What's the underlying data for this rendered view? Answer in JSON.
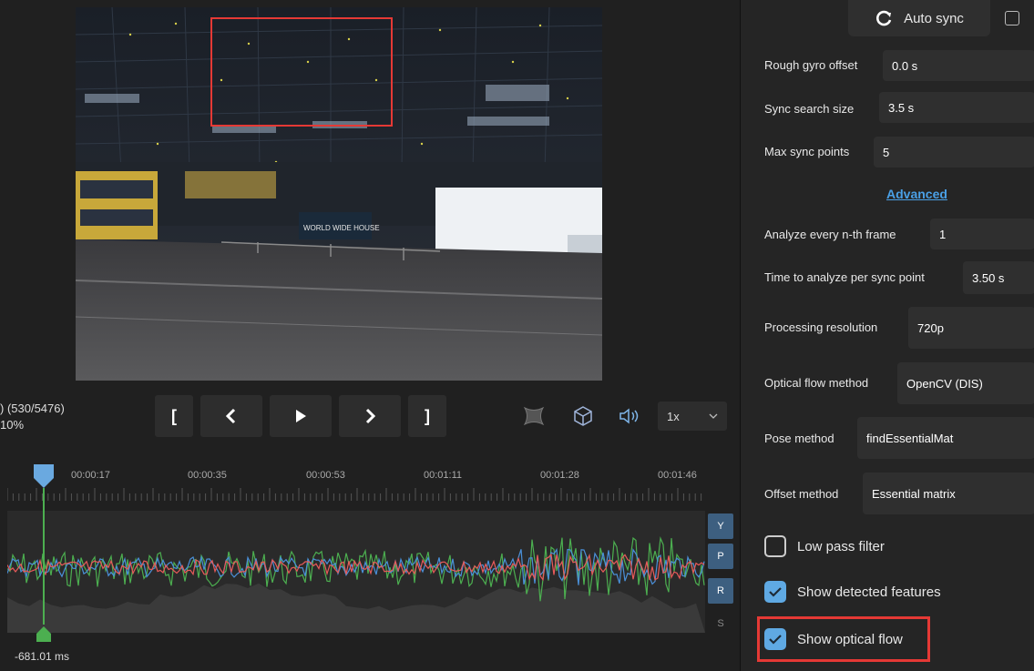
{
  "player": {
    "frame_line1": ") (530/5476)",
    "frame_line2": "10%",
    "btn_start": "[",
    "btn_end": "]",
    "speed": "1x",
    "timeline_ticks": [
      "00:00:17",
      "00:00:35",
      "00:00:53",
      "00:01:11",
      "00:01:28",
      "00:01:46"
    ],
    "channels": [
      "Y",
      "P",
      "R",
      "S"
    ],
    "offset": "-681.01 ms",
    "video_sign": "WORLD WIDE HOUSE"
  },
  "sync": {
    "auto_sync_label": "Auto sync",
    "rough_gyro_offset_label": "Rough gyro offset",
    "rough_gyro_offset_value": "0.0 s",
    "sync_search_size_label": "Sync search size",
    "sync_search_size_value": "3.5 s",
    "max_sync_points_label": "Max sync points",
    "max_sync_points_value": "5",
    "advanced_label": "Advanced",
    "analyze_every_label": "Analyze every n-th frame",
    "analyze_every_value": "1",
    "time_to_analyze_label": "Time to analyze per sync point",
    "time_to_analyze_value": "3.50 s",
    "processing_resolution_label": "Processing resolution",
    "processing_resolution_value": "720p",
    "optical_flow_method_label": "Optical flow method",
    "optical_flow_method_value": "OpenCV (DIS)",
    "pose_method_label": "Pose method",
    "pose_method_value": "findEssentialMat",
    "offset_method_label": "Offset method",
    "offset_method_value": "Essential matrix",
    "low_pass_label": "Low pass filter",
    "low_pass_checked": false,
    "show_detected_label": "Show detected features",
    "show_detected_checked": true,
    "show_flow_label": "Show optical flow",
    "show_flow_checked": true
  },
  "colors": {
    "accent": "#5fa9e3",
    "highlight": "#e53935",
    "series_yaw": "#e85a5a",
    "series_pitch": "#4caf50",
    "series_roll": "#4a90d9",
    "playhead": "#4caf50"
  }
}
